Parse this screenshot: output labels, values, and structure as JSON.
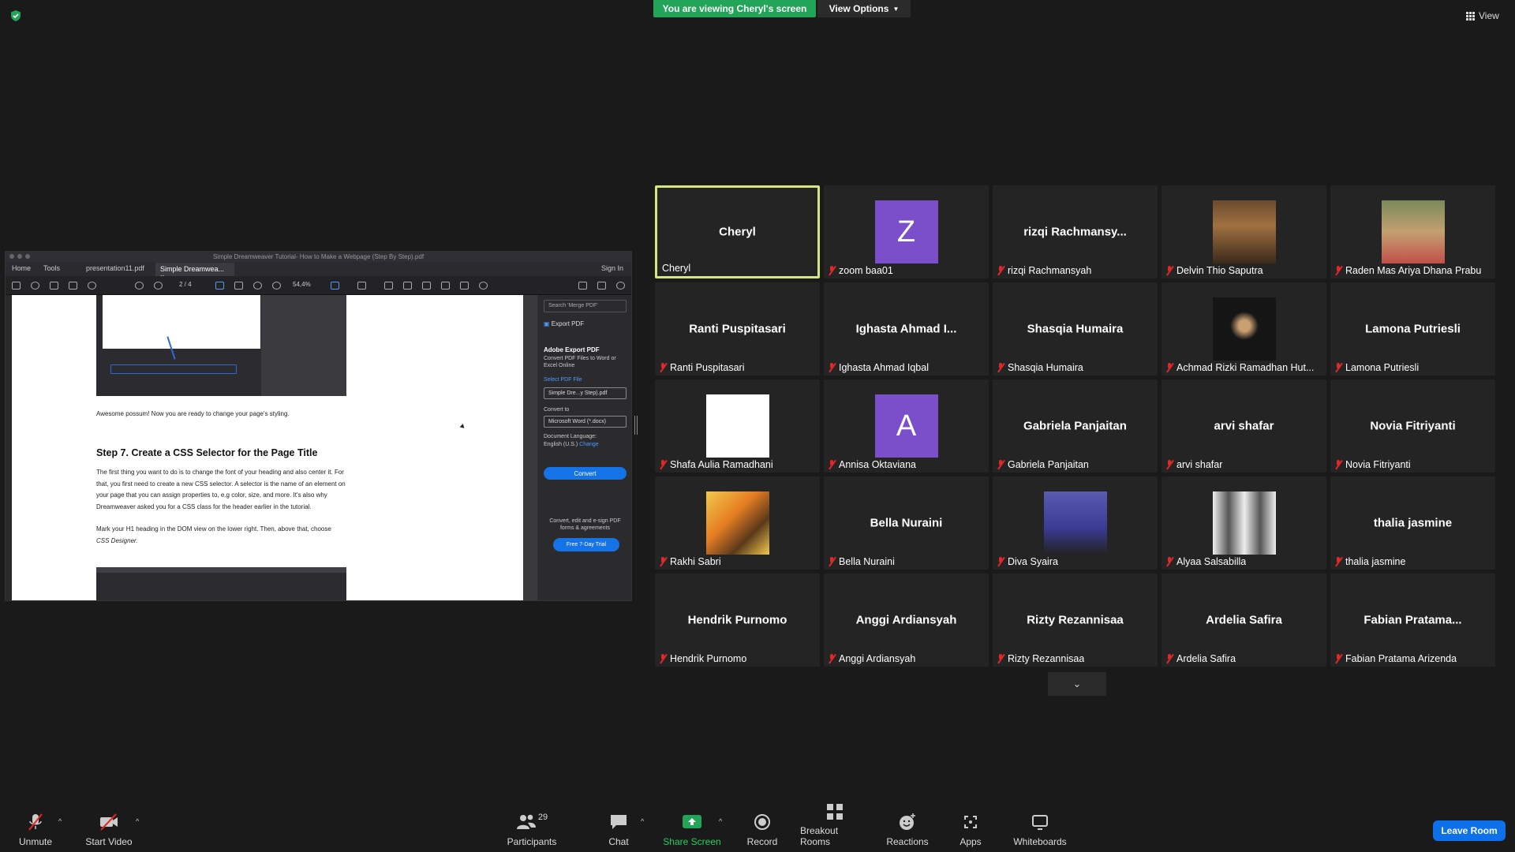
{
  "colors": {
    "accent_green": "#23a559",
    "active_border": "#d6e581",
    "leave_blue": "#0e71eb",
    "muted_red": "#e02828",
    "avatar_purple": "#7b4fc9"
  },
  "header": {
    "banner": "You are viewing Cheryl's screen",
    "view_options": "View Options",
    "view": "View"
  },
  "shared": {
    "title": "Simple Dreamweaver Tutorial- How to Make a Webpage (Step By Step).pdf",
    "tabs": {
      "home": "Home",
      "tools": "Tools",
      "file1": "presentation11.pdf",
      "file2": "Simple Dreamwea...",
      "signin": "Sign In"
    },
    "page": "2  /  4",
    "zoom": "54,4%",
    "doc": {
      "line1": "Awesome possum! Now you are ready to change your page's styling.",
      "heading": "Step 7. Create a CSS Selector for the Page Title",
      "para1": "The first thing you want to do is to change the font of your heading and also center it. For that, you first need to create a new CSS selector. A selector is the name of an element on your page that you can assign properties to, e.g color, size, and more. It's also why Dreamweaver asked you for a CSS class for the header earlier in the tutorial.",
      "para2a": "Mark your H1 heading in the DOM view on the lower right. Then, above that, choose",
      "para2b": "CSS Designer."
    },
    "panel": {
      "search": "Search 'Merge PDF'",
      "export_head": "Export PDF",
      "title": "Adobe Export PDF",
      "sub": "Convert PDF Files to Word or Excel Online",
      "select_label": "Select PDF File",
      "file": "Simple Dre...y Step).pdf",
      "convert_to": "Convert to",
      "format": "Microsoft Word (*.docx)",
      "doc_lang": "Document Language:",
      "lang": "English (U.S.)",
      "change": "Change",
      "convert": "Convert",
      "promo": "Convert, edit and e-sign PDF forms & agreements",
      "trial": "Free 7-Day Trial"
    }
  },
  "participants": [
    {
      "big": "Cheryl",
      "label": "Cheryl",
      "muted": false,
      "active": true
    },
    {
      "letter": "Z",
      "label": "zoom baa01",
      "muted": true
    },
    {
      "big": "rizqi  Rachmansy...",
      "label": "rizqi Rachmansyah",
      "muted": true
    },
    {
      "photo": "photo-a",
      "label": "Delvin Thio Saputra",
      "muted": true
    },
    {
      "photo": "photo-b",
      "label": "Raden Mas Ariya Dhana Prabu",
      "muted": true
    },
    {
      "big": "Ranti Puspitasari",
      "label": "Ranti Puspitasari",
      "muted": true
    },
    {
      "big": "Ighasta Ahmad I...",
      "label": "Ighasta Ahmad Iqbal",
      "muted": true
    },
    {
      "big": "Shasqia Humaira",
      "label": "Shasqia Humaira",
      "muted": true
    },
    {
      "photo": "photo-c",
      "label": "Achmad Rizki Ramadhan Hut...",
      "muted": true
    },
    {
      "big": "Lamona Putriesli",
      "label": "Lamona Putriesli",
      "muted": true
    },
    {
      "photo": "photo-white",
      "label": "Shafa Aulia Ramadhani",
      "muted": true
    },
    {
      "letter": "A",
      "label": "Annisa Oktaviana",
      "muted": true
    },
    {
      "big": "Gabriela Panjaitan",
      "label": "Gabriela Panjaitan",
      "muted": true
    },
    {
      "big": "arvi shafar",
      "label": "arvi shafar",
      "muted": true
    },
    {
      "big": "Novia Fitriyanti",
      "label": "Novia Fitriyanti",
      "muted": true
    },
    {
      "photo": "photo-d",
      "label": "Rakhi Sabri",
      "muted": true
    },
    {
      "big": "Bella Nuraini",
      "label": "Bella Nuraini",
      "muted": true
    },
    {
      "photo": "photo-e",
      "label": "Diva Syaira",
      "muted": true
    },
    {
      "photo": "photo-f",
      "label": "Alyaa Salsabilla",
      "muted": true
    },
    {
      "big": "thalia jasmine",
      "label": "thalia jasmine",
      "muted": true
    },
    {
      "big": "Hendrik Purnomo",
      "label": "Hendrik Purnomo",
      "muted": true
    },
    {
      "big": "Anggi Ardiansyah",
      "label": "Anggi Ardiansyah",
      "muted": true
    },
    {
      "big": "Rizty Rezannisaa",
      "label": "Rizty Rezannisaa",
      "muted": true
    },
    {
      "big": "Ardelia Safira",
      "label": "Ardelia Safira",
      "muted": true
    },
    {
      "big": "Fabian  Pratama...",
      "label": "Fabian Pratama Arizenda",
      "muted": true
    }
  ],
  "toolbar": {
    "unmute": "Unmute",
    "start_video": "Start Video",
    "participants": "Participants",
    "participant_count": "29",
    "chat": "Chat",
    "share_screen": "Share Screen",
    "record": "Record",
    "breakout_rooms": "Breakout Rooms",
    "reactions": "Reactions",
    "apps": "Apps",
    "whiteboards": "Whiteboards",
    "leave": "Leave Room"
  }
}
